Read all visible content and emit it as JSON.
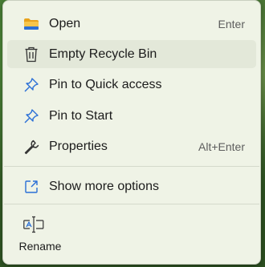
{
  "menu": {
    "items": [
      {
        "label": "Open",
        "shortcut": "Enter",
        "icon": "folder-icon"
      },
      {
        "label": "Empty Recycle Bin",
        "shortcut": "",
        "icon": "trash-icon"
      },
      {
        "label": "Pin to Quick access",
        "shortcut": "",
        "icon": "pin-icon"
      },
      {
        "label": "Pin to Start",
        "shortcut": "",
        "icon": "pin-icon"
      },
      {
        "label": "Properties",
        "shortcut": "Alt+Enter",
        "icon": "wrench-icon"
      }
    ],
    "more": {
      "label": "Show more options",
      "icon": "share-external-icon"
    },
    "actions": [
      {
        "label": "Rename",
        "icon": "rename-icon"
      }
    ],
    "colors": {
      "accent": "#2a6fd6",
      "folder": "#f4b62c",
      "surface": "#eff3e6"
    }
  }
}
